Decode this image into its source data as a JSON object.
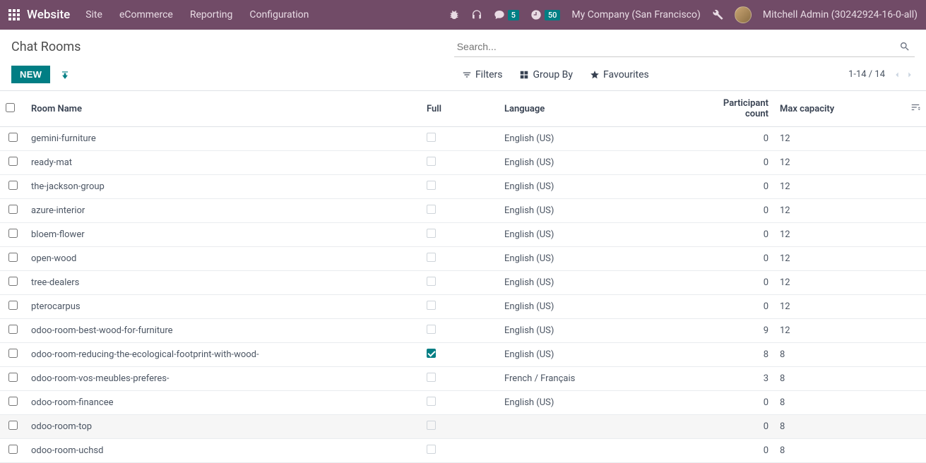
{
  "topbar": {
    "brand": "Website",
    "menu": [
      "Site",
      "eCommerce",
      "Reporting",
      "Configuration"
    ],
    "msg_badge": "5",
    "timer_badge": "50",
    "company": "My Company (San Francisco)",
    "user": "Mitchell Admin (30242924-16-0-all)"
  },
  "control": {
    "title": "Chat Rooms",
    "new_label": "NEW",
    "search_placeholder": "Search...",
    "filters_label": "Filters",
    "groupby_label": "Group By",
    "favourites_label": "Favourites",
    "pager": "1-14 / 14"
  },
  "columns": {
    "name": "Room Name",
    "full": "Full",
    "lang": "Language",
    "pc": "Participant count",
    "max": "Max capacity"
  },
  "rows": [
    {
      "name": "gemini-furniture",
      "full": false,
      "lang": "English (US)",
      "pc": "0",
      "max": "12"
    },
    {
      "name": "ready-mat",
      "full": false,
      "lang": "English (US)",
      "pc": "0",
      "max": "12"
    },
    {
      "name": "the-jackson-group",
      "full": false,
      "lang": "English (US)",
      "pc": "0",
      "max": "12"
    },
    {
      "name": "azure-interior",
      "full": false,
      "lang": "English (US)",
      "pc": "0",
      "max": "12"
    },
    {
      "name": "bloem-flower",
      "full": false,
      "lang": "English (US)",
      "pc": "0",
      "max": "12"
    },
    {
      "name": "open-wood",
      "full": false,
      "lang": "English (US)",
      "pc": "0",
      "max": "12"
    },
    {
      "name": "tree-dealers",
      "full": false,
      "lang": "English (US)",
      "pc": "0",
      "max": "12"
    },
    {
      "name": "pterocarpus",
      "full": false,
      "lang": "English (US)",
      "pc": "0",
      "max": "12"
    },
    {
      "name": "odoo-room-best-wood-for-furniture",
      "full": false,
      "lang": "English (US)",
      "pc": "9",
      "max": "12"
    },
    {
      "name": "odoo-room-reducing-the-ecological-footprint-with-wood-",
      "full": true,
      "lang": "English (US)",
      "pc": "8",
      "max": "8"
    },
    {
      "name": "odoo-room-vos-meubles-preferes-",
      "full": false,
      "lang": "French / Français",
      "pc": "3",
      "max": "8"
    },
    {
      "name": "odoo-room-financee",
      "full": false,
      "lang": "English (US)",
      "pc": "0",
      "max": "8"
    },
    {
      "name": "odoo-room-top",
      "full": false,
      "lang": "",
      "pc": "0",
      "max": "8"
    },
    {
      "name": "odoo-room-uchsd",
      "full": false,
      "lang": "",
      "pc": "0",
      "max": "8"
    }
  ]
}
